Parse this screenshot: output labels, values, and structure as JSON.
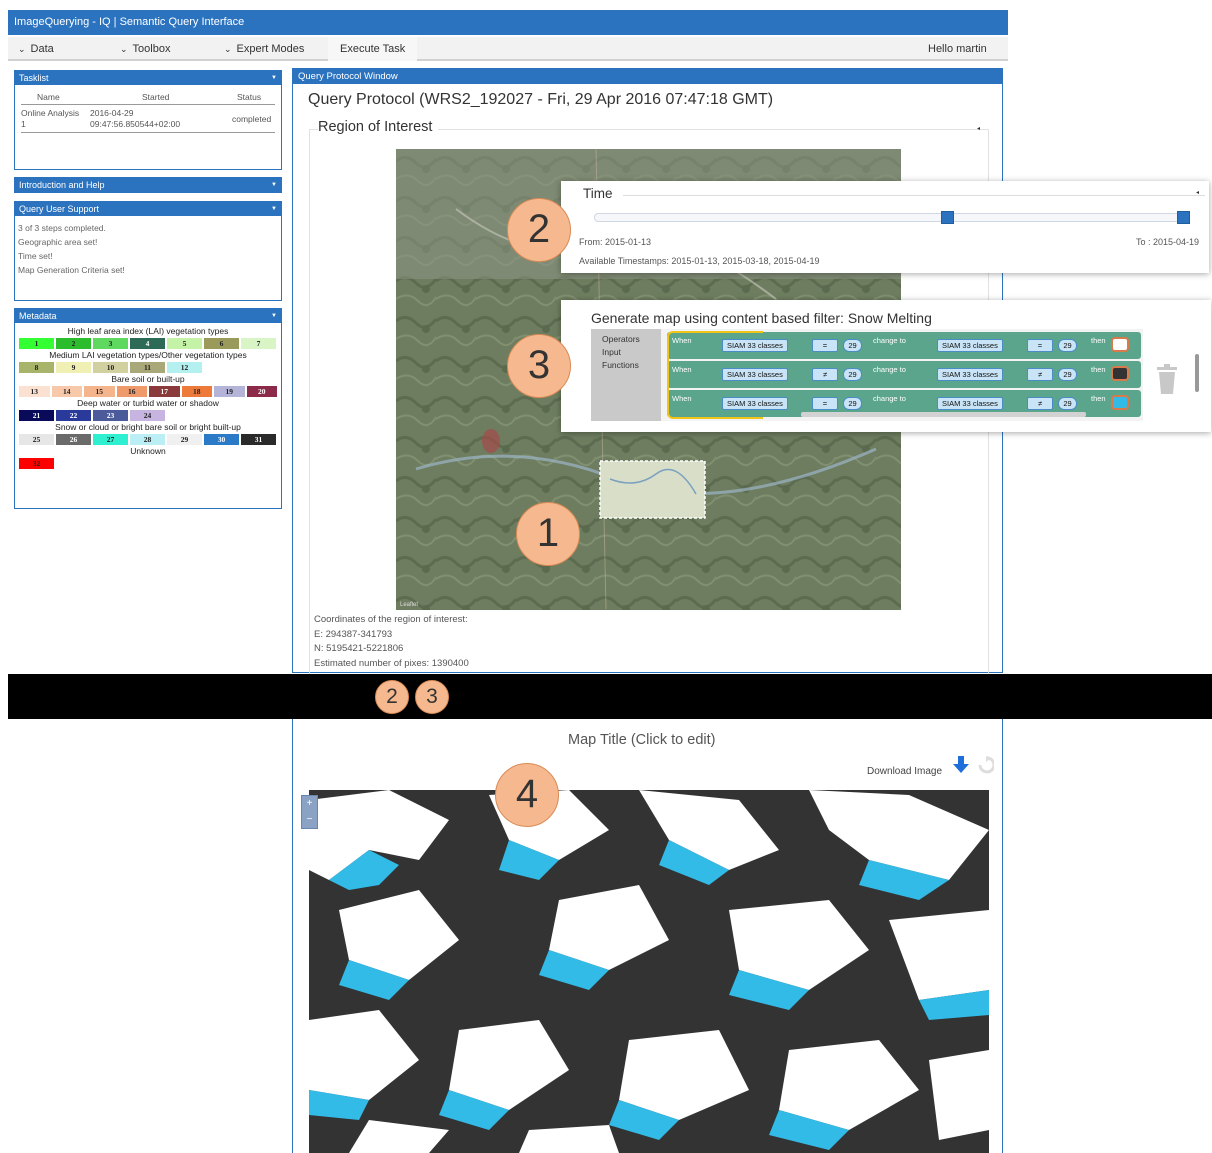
{
  "app": {
    "title": "ImageQuerying - IQ | Semantic Query Interface"
  },
  "menu": {
    "data": "Data",
    "toolbox": "Toolbox",
    "expert": "Expert Modes",
    "execute": "Execute Task",
    "greeting": "Hello martin"
  },
  "tasklist": {
    "title": "Tasklist",
    "headers": {
      "name": "Name",
      "started": "Started",
      "status": "Status"
    },
    "row": {
      "name": "Online Analysis",
      "name2": "1",
      "started1": "2016-04-29",
      "started2": "09:47:56.850544+02:00",
      "status": "completed"
    }
  },
  "intro": {
    "title": "Introduction and Help"
  },
  "support": {
    "title": "Query User Support",
    "lines": [
      "3 of 3 steps completed.",
      "Geographic area set!",
      "Time set!",
      "Map Generation Criteria set!"
    ]
  },
  "metadata": {
    "title": "Metadata",
    "groups": [
      {
        "title": "High leaf area index (LAI) vegetation types",
        "cells": [
          {
            "n": "1",
            "color": "#33ff33"
          },
          {
            "n": "2",
            "color": "#2cbd2c"
          },
          {
            "n": "3",
            "color": "#5fd85f"
          },
          {
            "n": "4",
            "color": "#2e6b57"
          },
          {
            "n": "5",
            "color": "#c4f2a6"
          },
          {
            "n": "6",
            "color": "#9a9a5a"
          },
          {
            "n": "7",
            "color": "#d9f5c5"
          }
        ]
      },
      {
        "title": "Medium LAI vegetation types/Other vegetation types",
        "cells": [
          {
            "n": "8",
            "color": "#a8b46a"
          },
          {
            "n": "9",
            "color": "#f0f0b4"
          },
          {
            "n": "10",
            "color": "#d0d0a0"
          },
          {
            "n": "11",
            "color": "#a8a878"
          },
          {
            "n": "12",
            "color": "#b4f0f0"
          }
        ]
      },
      {
        "title": "Bare soil or built-up",
        "cells": [
          {
            "n": "13",
            "color": "#fbe1d2"
          },
          {
            "n": "14",
            "color": "#f7c9aa"
          },
          {
            "n": "15",
            "color": "#f4b58c"
          },
          {
            "n": "16",
            "color": "#ee9a6a"
          },
          {
            "n": "17",
            "color": "#8a3a3a"
          },
          {
            "n": "18",
            "color": "#ee7a3a"
          },
          {
            "n": "19",
            "color": "#b4b4d8"
          },
          {
            "n": "20",
            "color": "#8c2a4a"
          }
        ]
      },
      {
        "title": "Deep water or turbid water or shadow",
        "cells": [
          {
            "n": "21",
            "color": "#0a0a5a"
          },
          {
            "n": "22",
            "color": "#2a3a9a"
          },
          {
            "n": "23",
            "color": "#4a5a9a"
          },
          {
            "n": "24",
            "color": "#c8b4e0"
          }
        ]
      },
      {
        "title": "Snow or cloud or bright bare soil or bright built-up",
        "cells": [
          {
            "n": "25",
            "color": "#e6e6e6"
          },
          {
            "n": "26",
            "color": "#6a6a6a"
          },
          {
            "n": "27",
            "color": "#2ef0d0"
          },
          {
            "n": "28",
            "color": "#bceef5"
          },
          {
            "n": "29",
            "color": "#f0f0f0"
          },
          {
            "n": "30",
            "color": "#2a7ac8"
          },
          {
            "n": "31",
            "color": "#2a2a2a"
          }
        ]
      },
      {
        "title": "Unknown",
        "cells": [
          {
            "n": "32",
            "color": "#ff0000"
          }
        ]
      }
    ]
  },
  "qp": {
    "window_title": "Query Protocol Window",
    "heading": "Query Protocol (WRS2_192027 - Fri, 29 Apr 2016 07:47:18 GMT)",
    "roi_title": "Region of Interest",
    "coords": {
      "label": "Coordinates of the region of interest:",
      "e": "E: 294387-341793",
      "n": "N: 5195421-5221806",
      "pixels": "Estimated number of pixes: 1390400"
    }
  },
  "time": {
    "title": "Time",
    "from": "From: 2015-01-13",
    "to": "To : 2015-04-19",
    "available": "Available Timestamps: 2015-01-13, 2015-03-18, 2015-04-19",
    "handle_positions": [
      0.6,
      1.0
    ]
  },
  "generate": {
    "title": "Generate map using content based filter: Snow Melting",
    "side": [
      "Operators",
      "Input",
      "Functions"
    ],
    "rows": [
      {
        "when": "When",
        "class1": "SIAM 33 classes",
        "op1": "=",
        "val1": "29",
        "change": "change to",
        "class2": "SIAM 33 classes",
        "op2": "=",
        "val2": "29",
        "then": "then",
        "color": "#ffffff"
      },
      {
        "when": "When",
        "class1": "SIAM 33 classes",
        "op1": "≠",
        "val1": "29",
        "change": "change to",
        "class2": "SIAM 33 classes",
        "op2": "≠",
        "val2": "29",
        "then": "then",
        "color": "#333333"
      },
      {
        "when": "When",
        "class1": "SIAM 33 classes",
        "op1": "=",
        "val1": "29",
        "change": "change to",
        "class2": "SIAM 33 classes",
        "op2": "≠",
        "val2": "29",
        "then": "then",
        "color": "#33bbe8"
      }
    ]
  },
  "badges": {
    "b1": "1",
    "b2": "2",
    "b3": "3",
    "b4": "4",
    "strip2": "2",
    "strip3": "3"
  },
  "result": {
    "map_title": "Map Title (Click to edit)",
    "download": "Download Image",
    "zoom_in": "+",
    "zoom_out": "−"
  }
}
